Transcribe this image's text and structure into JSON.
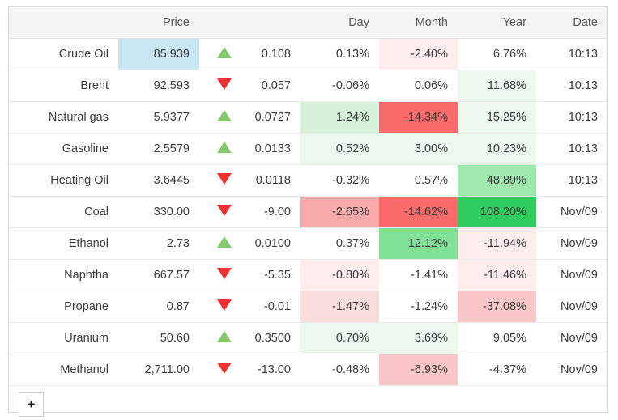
{
  "table": {
    "columns": [
      {
        "key": "name",
        "label": ""
      },
      {
        "key": "price",
        "label": "Price"
      },
      {
        "key": "arrow",
        "label": ""
      },
      {
        "key": "change",
        "label": ""
      },
      {
        "key": "day",
        "label": "Day"
      },
      {
        "key": "month",
        "label": "Month"
      },
      {
        "key": "year",
        "label": "Year"
      },
      {
        "key": "date",
        "label": "Date"
      }
    ],
    "rows": [
      {
        "name": "Crude Oil",
        "price": "85.939",
        "price_highlight": true,
        "arrow": "triangle-up-icon",
        "change": "0.108",
        "change_dir": "up",
        "day": "0.13%",
        "day_dir": "up",
        "day_bg": "none",
        "month": "-2.40%",
        "month_dir": "down",
        "month_bg": "r1",
        "year": "6.76%",
        "year_dir": "neutral",
        "year_bg": "none",
        "date": "10:13"
      },
      {
        "name": "Brent",
        "price": "92.593",
        "price_highlight": false,
        "arrow": "triangle-down-icon",
        "change": "0.057",
        "change_dir": "down",
        "day": "-0.06%",
        "day_dir": "down",
        "day_bg": "none",
        "month": "0.06%",
        "month_dir": "neutral",
        "month_bg": "none",
        "year": "11.68%",
        "year_dir": "neutral",
        "year_bg": "g1",
        "date": "10:13"
      },
      {
        "name": "Natural gas",
        "price": "5.9377",
        "price_highlight": false,
        "arrow": "triangle-up-icon",
        "change": "0.0727",
        "change_dir": "up",
        "day": "1.24%",
        "day_dir": "up",
        "day_bg": "g2",
        "month": "-14.34%",
        "month_dir": "neutral",
        "month_bg": "r5",
        "year": "15.25%",
        "year_dir": "neutral",
        "year_bg": "g1",
        "date": "10:13"
      },
      {
        "name": "Gasoline",
        "price": "2.5579",
        "price_highlight": false,
        "arrow": "triangle-up-icon",
        "change": "0.0133",
        "change_dir": "up",
        "day": "0.52%",
        "day_dir": "up",
        "day_bg": "g1",
        "month": "3.00%",
        "month_dir": "neutral",
        "month_bg": "g1",
        "year": "10.23%",
        "year_dir": "neutral",
        "year_bg": "g1",
        "date": "10:13"
      },
      {
        "name": "Heating Oil",
        "price": "3.6445",
        "price_highlight": false,
        "arrow": "triangle-down-icon",
        "change": "0.0118",
        "change_dir": "down",
        "day": "-0.32%",
        "day_dir": "down",
        "day_bg": "none",
        "month": "0.57%",
        "month_dir": "neutral",
        "month_bg": "none",
        "year": "48.89%",
        "year_dir": "neutral",
        "year_bg": "g3",
        "date": "10:13"
      },
      {
        "name": "Coal",
        "price": "330.00",
        "price_highlight": false,
        "arrow": "triangle-down-icon",
        "change": "-9.00",
        "change_dir": "flat",
        "day": "-2.65%",
        "day_dir": "neutral",
        "day_bg": "r4",
        "month": "-14.62%",
        "month_dir": "neutral",
        "month_bg": "r5",
        "year": "108.20%",
        "year_dir": "neutral",
        "year_bg": "g5",
        "date": "Nov/09"
      },
      {
        "name": "Ethanol",
        "price": "2.73",
        "price_highlight": false,
        "arrow": "triangle-up-icon",
        "change": "0.0100",
        "change_dir": "up",
        "day": "0.37%",
        "day_dir": "neutral",
        "day_bg": "none",
        "month": "12.12%",
        "month_dir": "neutral",
        "month_bg": "g4",
        "year": "-11.94%",
        "year_dir": "neutral",
        "year_bg": "r1",
        "date": "Nov/09"
      },
      {
        "name": "Naphtha",
        "price": "667.57",
        "price_highlight": false,
        "arrow": "triangle-down-icon",
        "change": "-5.35",
        "change_dir": "flat",
        "day": "-0.80%",
        "day_dir": "neutral",
        "day_bg": "r1",
        "month": "-1.41%",
        "month_dir": "neutral",
        "month_bg": "none",
        "year": "-11.46%",
        "year_dir": "neutral",
        "year_bg": "r1",
        "date": "Nov/09"
      },
      {
        "name": "Propane",
        "price": "0.87",
        "price_highlight": false,
        "arrow": "triangle-down-icon",
        "change": "-0.01",
        "change_dir": "flat",
        "day": "-1.47%",
        "day_dir": "neutral",
        "day_bg": "r2",
        "month": "-1.24%",
        "month_dir": "neutral",
        "month_bg": "none",
        "year": "-37.08%",
        "year_dir": "neutral",
        "year_bg": "r3",
        "date": "Nov/09"
      },
      {
        "name": "Uranium",
        "price": "50.60",
        "price_highlight": false,
        "arrow": "triangle-up-icon",
        "change": "0.3500",
        "change_dir": "up",
        "day": "0.70%",
        "day_dir": "neutral",
        "day_bg": "g1",
        "month": "3.69%",
        "month_dir": "neutral",
        "month_bg": "g1",
        "year": "9.05%",
        "year_dir": "neutral",
        "year_bg": "none",
        "date": "Nov/09"
      },
      {
        "name": "Methanol",
        "price": "2,711.00",
        "price_highlight": false,
        "arrow": "triangle-down-icon",
        "change": "-13.00",
        "change_dir": "flat",
        "day": "-0.48%",
        "day_dir": "neutral",
        "day_bg": "none",
        "month": "-6.93%",
        "month_dir": "neutral",
        "month_bg": "r3",
        "year": "-4.37%",
        "year_dir": "neutral",
        "year_bg": "none",
        "date": "Nov/09"
      }
    ]
  },
  "footer": {
    "add_label": "+"
  },
  "colors": {
    "price_highlight": "#cbe7f5",
    "up_arrow": "#84ca6a",
    "down_arrow": "#f03131",
    "up_text": "#2e7d32",
    "down_text": "#9b1b1b",
    "header_bg": "#f5f5f5",
    "strong_green": "#2ecc5d",
    "strong_red": "#f96a6a"
  }
}
